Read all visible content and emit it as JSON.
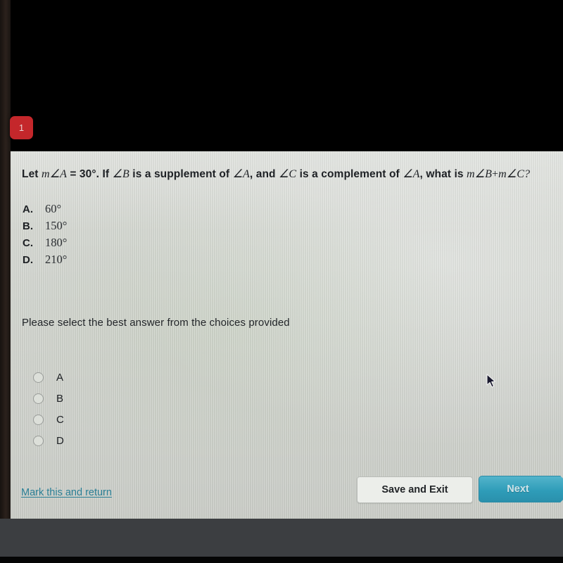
{
  "quiz": {
    "question_number": "1",
    "question": {
      "prefix": "Let ",
      "m1": "m",
      "angle_a1": "∠A",
      "eq": " = 30°. If ",
      "angle_b": "∠B",
      "mid1": " is a supplement of ",
      "angle_a2": "∠A",
      "mid2": ", and ",
      "angle_c": "∠C",
      "mid3": " is a complement of ",
      "angle_a3": "∠A",
      "mid4": ", what is ",
      "m2": "m",
      "angle_b2": "∠B",
      "plus": "+",
      "m3": "m",
      "angle_c2": "∠C",
      "qmark": "?",
      "full_text": "Let m∠A = 30°. If ∠B is a supplement of ∠A, and ∠C is a complement of ∠A, what is m∠B + m∠C?"
    },
    "choices": [
      {
        "letter": "A.",
        "value": "60°"
      },
      {
        "letter": "B.",
        "value": "150°"
      },
      {
        "letter": "C.",
        "value": "180°"
      },
      {
        "letter": "D.",
        "value": "210°"
      }
    ],
    "instruction": "Please select the best answer from the choices provided",
    "radio_options": [
      {
        "label": "A",
        "selected": false
      },
      {
        "label": "B",
        "selected": false
      },
      {
        "label": "C",
        "selected": false
      },
      {
        "label": "D",
        "selected": false
      }
    ],
    "footer": {
      "mark_link": "Mark this and return",
      "save_button": "Save and Exit",
      "next_button": "Next"
    }
  },
  "colors": {
    "badge_red": "#c4272b",
    "next_teal": "#2e9cb8",
    "link_teal": "#2a7f96",
    "card_bg": "#d4d7d1",
    "frame_black": "#000000",
    "frame_gray": "#3c3e41"
  }
}
